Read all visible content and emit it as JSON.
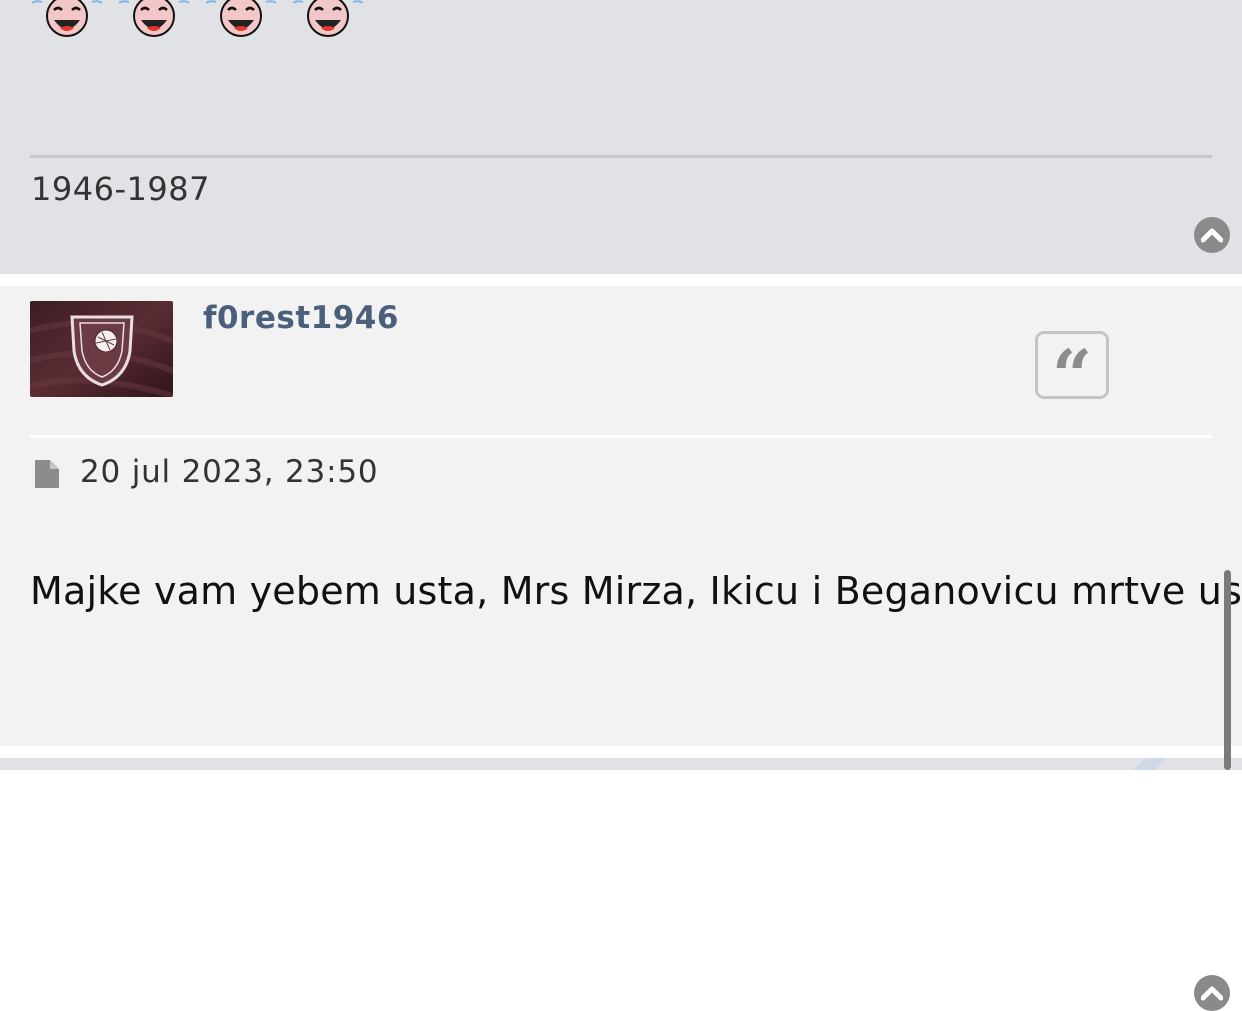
{
  "previous_post": {
    "smiley_icons": [
      "laughing-smiley-icon",
      "laughing-smiley-icon",
      "laughing-smiley-icon",
      "laughing-smiley-icon"
    ],
    "signature": "1946-1987",
    "back_to_top_icon": "chevron-up-icon"
  },
  "current_post": {
    "username": "f0rest1946",
    "avatar_icon": "fk-sarajevo-crest-avatar",
    "quote_icon": "quote-icon",
    "post_icon": "document-icon",
    "date": "20 jul 2023, 23:50",
    "content": "Majke vam yebem usta, Mrs Mirza, Ikicu i Beganovicu mrtve usta",
    "back_to_top_icon": "chevron-up-icon"
  },
  "colors": {
    "username": "#4a5f7c",
    "post_bg_alt": "#e1e2e6",
    "post_bg": "#f2f2f2"
  }
}
